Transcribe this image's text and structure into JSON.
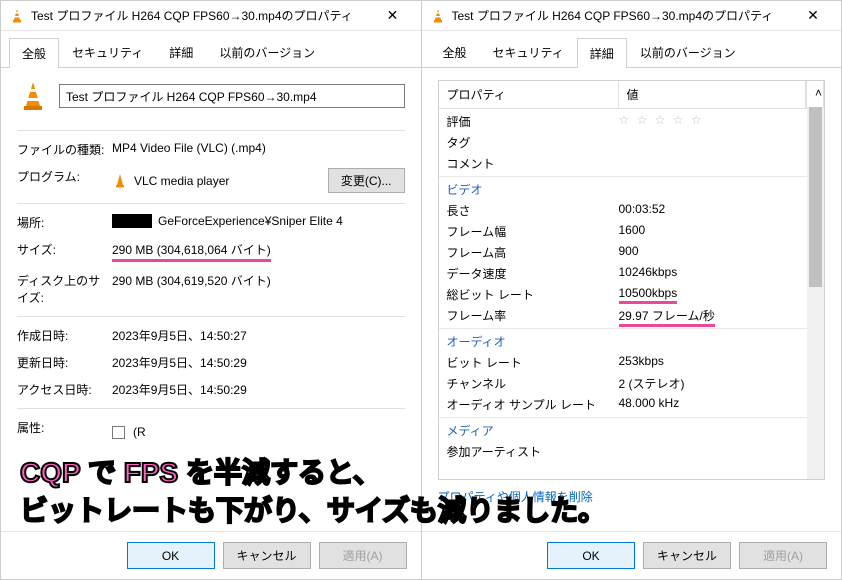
{
  "left": {
    "title": "Test プロファイル H264 CQP FPS60→30.mp4のプロパティ",
    "tabs": [
      "全般",
      "セキュリティ",
      "詳細",
      "以前のバージョン"
    ],
    "activeTab": 0,
    "filename": "Test プロファイル H264 CQP FPS60→30.mp4",
    "rows": {
      "filetype_label": "ファイルの種類:",
      "filetype": "MP4 Video File (VLC) (.mp4)",
      "program_label": "プログラム:",
      "program": "VLC media player",
      "change": "変更(C)...",
      "location_label": "場所:",
      "location_suffix": "GeForceExperience¥Sniper Elite 4",
      "size_label": "サイズ:",
      "size": "290 MB (304,618,064 バイト)",
      "disksize_label": "ディスク上のサイズ:",
      "disksize": "290 MB (304,619,520 バイト)",
      "created_label": "作成日時:",
      "created": "2023年9月5日、14:50:27",
      "modified_label": "更新日時:",
      "modified": "2023年9月5日、14:50:29",
      "accessed_label": "アクセス日時:",
      "accessed": "2023年9月5日、14:50:29",
      "attrs_label": "属性:",
      "attrs_r": "(R"
    }
  },
  "right": {
    "title": "Test プロファイル H264 CQP FPS60→30.mp4のプロパティ",
    "tabs": [
      "全般",
      "セキュリティ",
      "詳細",
      "以前のバージョン"
    ],
    "activeTab": 2,
    "header_prop": "プロパティ",
    "header_val": "値",
    "sections": {
      "rating": "評価",
      "tag": "タグ",
      "comment": "コメント",
      "video": "ビデオ",
      "length": "長さ",
      "length_v": "00:03:52",
      "fw": "フレーム幅",
      "fw_v": "1600",
      "fh": "フレーム高",
      "fh_v": "900",
      "datarate": "データ速度",
      "datarate_v": "10246kbps",
      "totalbr": "総ビット レート",
      "totalbr_v": "10500kbps",
      "fps": "フレーム率",
      "fps_v": "29.97 フレーム/秒",
      "audio": "オーディオ",
      "abr": "ビット レート",
      "abr_v": "253kbps",
      "ch": "チャンネル",
      "ch_v": "2 (ステレオ)",
      "sr": "オーディオ サンプル レート",
      "sr_v": "48.000 kHz",
      "media": "メディア",
      "artist": "参加アーティスト"
    },
    "remove_link": "プロパティや個人情報を削除"
  },
  "buttons": {
    "ok": "OK",
    "cancel": "キャンセル",
    "apply": "適用(A)"
  },
  "overlay": "CQP で FPS を半減すると、\nビットレートも下がり、サイズも減りました。"
}
